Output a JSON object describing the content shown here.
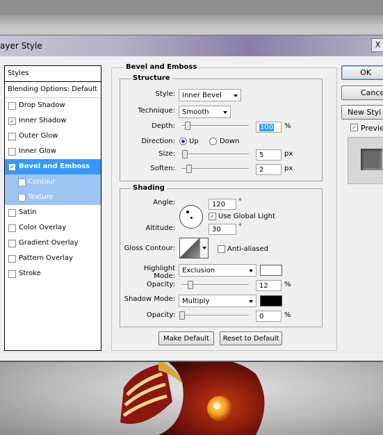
{
  "window": {
    "title": "ayer Style",
    "close_glyph": "X"
  },
  "sidebar": {
    "header": "Styles",
    "blending": "Blending Options: Default",
    "items": [
      {
        "label": "Drop Shadow",
        "checked": false
      },
      {
        "label": "Inner Shadow",
        "checked": true
      },
      {
        "label": "Outer Glow",
        "checked": false
      },
      {
        "label": "Inner Glow",
        "checked": false
      },
      {
        "label": "Bevel and Emboss",
        "checked": true,
        "selected": true
      },
      {
        "label": "Contour",
        "checked": false,
        "sub": true
      },
      {
        "label": "Texture",
        "checked": false,
        "sub": true
      },
      {
        "label": "Satin",
        "checked": false
      },
      {
        "label": "Color Overlay",
        "checked": false
      },
      {
        "label": "Gradient Overlay",
        "checked": false
      },
      {
        "label": "Pattern Overlay",
        "checked": false
      },
      {
        "label": "Stroke",
        "checked": false
      }
    ]
  },
  "bevel": {
    "group_title": "Bevel and Emboss",
    "structure": {
      "title": "Structure",
      "style_label": "Style:",
      "style_value": "Inner Bevel",
      "technique_label": "Technique:",
      "technique_value": "Smooth",
      "depth_label": "Depth:",
      "depth_value": "100",
      "depth_unit": "%",
      "direction_label": "Direction:",
      "dir_up": "Up",
      "dir_down": "Down",
      "direction_selected": "Up",
      "size_label": "Size:",
      "size_value": "5",
      "size_unit": "px",
      "soften_label": "Soften:",
      "soften_value": "2",
      "soften_unit": "px"
    },
    "shading": {
      "title": "Shading",
      "angle_label": "Angle:",
      "angle_value": "120",
      "angle_unit": "°",
      "use_global_light": "Use Global Light",
      "use_global_light_checked": true,
      "altitude_label": "Altitude:",
      "altitude_value": "30",
      "altitude_unit": "°",
      "gloss_label": "Gloss Contour:",
      "anti_aliased": "Anti-aliased",
      "anti_aliased_checked": false,
      "highlight_mode_label": "Highlight Mode:",
      "highlight_mode_value": "Exclusion",
      "highlight_color": "#ffffff",
      "highlight_opacity_label": "Opacity:",
      "highlight_opacity_value": "12",
      "highlight_opacity_unit": "%",
      "shadow_mode_label": "Shadow Mode:",
      "shadow_mode_value": "Multiply",
      "shadow_color": "#000000",
      "shadow_opacity_label": "Opacity:",
      "shadow_opacity_value": "0",
      "shadow_opacity_unit": "%"
    },
    "make_default": "Make Default",
    "reset_default": "Reset to Default"
  },
  "actions": {
    "ok": "OK",
    "cancel": "Cance",
    "new_style": "New Styl",
    "preview": "Previe",
    "preview_checked": true
  }
}
